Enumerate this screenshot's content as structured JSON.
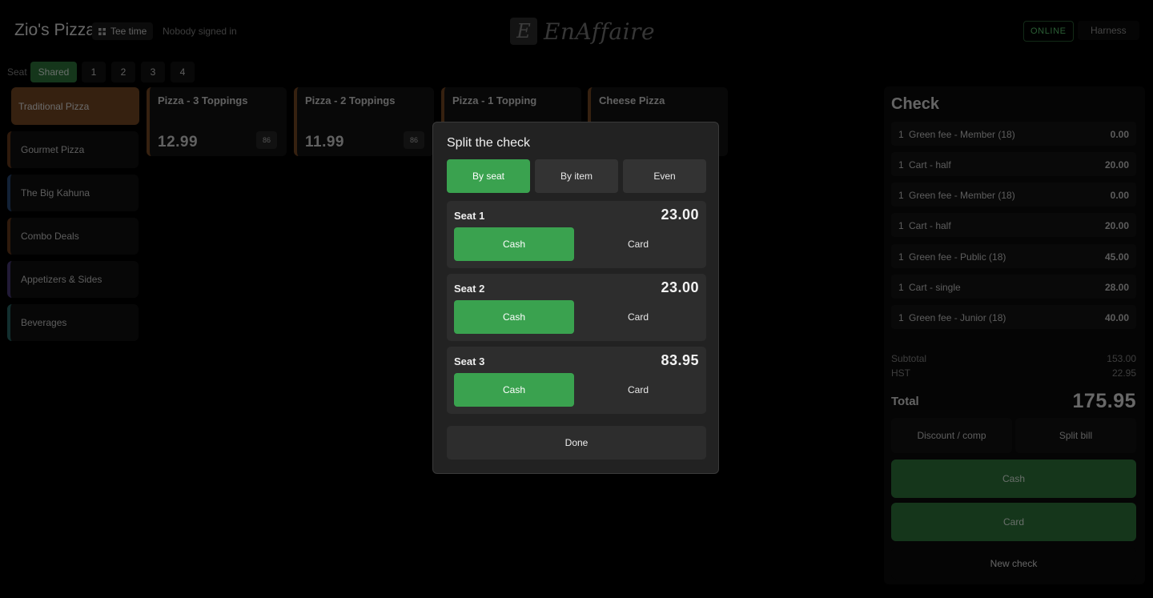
{
  "header": {
    "brand": "Zio's Pizza",
    "tee_time_label": "Tee time",
    "signed_in_status": "Nobody signed in",
    "logo_initial": "E",
    "logo_text": "EnAffaire",
    "online_status": "ONLINE",
    "user_name": "Harness"
  },
  "seats": {
    "label": "Seat",
    "items": [
      "Shared",
      "1",
      "2",
      "3",
      "4"
    ],
    "selected": "Shared"
  },
  "categories": [
    {
      "label": "Traditional Pizza",
      "color": "#7a4a24"
    },
    {
      "label": "Gourmet Pizza",
      "color": "#6a3a1c"
    },
    {
      "label": "The Big Kahuna",
      "color": "#2a4a7a"
    },
    {
      "label": "Combo Deals",
      "color": "#6a3a1c"
    },
    {
      "label": "Appetizers & Sides",
      "color": "#4a3a7a"
    },
    {
      "label": "Beverages",
      "color": "#2a6a6a"
    }
  ],
  "menu_items": [
    {
      "name": "Pizza - 3 Toppings",
      "price": "12.99",
      "code": "86"
    },
    {
      "name": "Pizza - 2 Toppings",
      "price": "11.99",
      "code": "86"
    },
    {
      "name": "Pizza - 1 Topping",
      "price": "",
      "code": ""
    },
    {
      "name": "Cheese Pizza",
      "price": "",
      "code": ""
    }
  ],
  "check": {
    "title": "Check",
    "lines": [
      {
        "qty": "1",
        "name": "Green fee - Member (18)",
        "price": "0.00"
      },
      {
        "qty": "1",
        "name": "Cart - half",
        "price": "20.00"
      },
      {
        "qty": "1",
        "name": "Green fee - Member (18)",
        "price": "0.00"
      },
      {
        "qty": "1",
        "name": "Cart - half",
        "price": "20.00"
      },
      {
        "qty": "1",
        "name": "Green fee - Public (18)",
        "price": "45.00"
      },
      {
        "qty": "1",
        "name": "Cart - single",
        "price": "28.00"
      },
      {
        "qty": "1",
        "name": "Green fee - Junior (18)",
        "price": "40.00"
      }
    ],
    "subtotal_label": "Subtotal",
    "subtotal": "153.00",
    "tax_label": "HST",
    "tax": "22.95",
    "total_label": "Total",
    "total": "175.95",
    "discount_label": "Discount / comp",
    "split_label": "Split bill",
    "cash_label": "Cash",
    "card_label": "Card",
    "new_check_label": "New check"
  },
  "split_dialog": {
    "title": "Split the check",
    "tabs": [
      "By seat",
      "By item",
      "Even"
    ],
    "selected_tab": "By seat",
    "seats": [
      {
        "name": "Seat 1",
        "amount": "23.00",
        "cash_label": "Cash",
        "card_label": "Card",
        "selected_method": "Cash"
      },
      {
        "name": "Seat 2",
        "amount": "23.00",
        "cash_label": "Cash",
        "card_label": "Card",
        "selected_method": "Cash"
      },
      {
        "name": "Seat 3",
        "amount": "83.95",
        "cash_label": "Cash",
        "card_label": "Card",
        "selected_method": "Cash"
      }
    ],
    "done_label": "Done"
  }
}
